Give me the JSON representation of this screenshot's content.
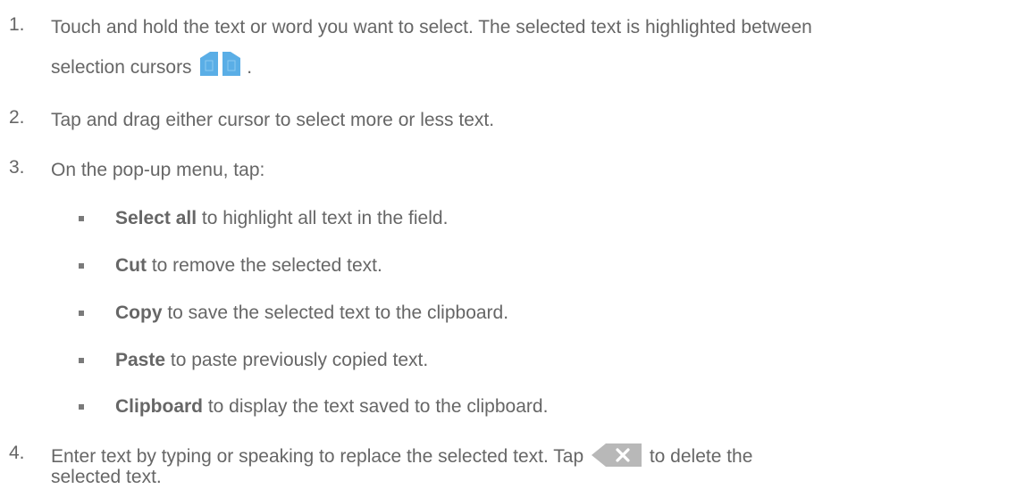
{
  "steps": [
    {
      "number": "1.",
      "line1": "Touch and hold the text or word you want to select. The selected text is highlighted between",
      "line2_before_icon": "selection cursors",
      "line2_after_icon": ".",
      "icon": "selection-cursors-icon"
    },
    {
      "number": "2.",
      "text": "Tap and drag either cursor to select more or less text."
    },
    {
      "number": "3.",
      "text": "On the pop-up menu, tap:",
      "bullets": [
        {
          "bold": "Select all",
          "rest": " to highlight all text in the field."
        },
        {
          "bold": "Cut",
          "rest": " to remove the selected text."
        },
        {
          "bold": "Copy",
          "rest": " to save the selected text to the clipboard."
        },
        {
          "bold": "Paste",
          "rest": " to paste previously copied text."
        },
        {
          "bold": "Clipboard",
          "rest": " to display the text saved to the clipboard."
        }
      ]
    },
    {
      "number": "4.",
      "line1_before_icon": "Enter text by typing or speaking to replace the selected text. Tap",
      "line1_after_icon": "to delete the",
      "line2": "selected text.",
      "icon": "backspace-delete-icon"
    }
  ],
  "colors": {
    "text": "#666666",
    "bullet": "#7a7a7a",
    "cursor_blue": "#5aaee6",
    "backspace_gray": "#b8b8b8"
  }
}
